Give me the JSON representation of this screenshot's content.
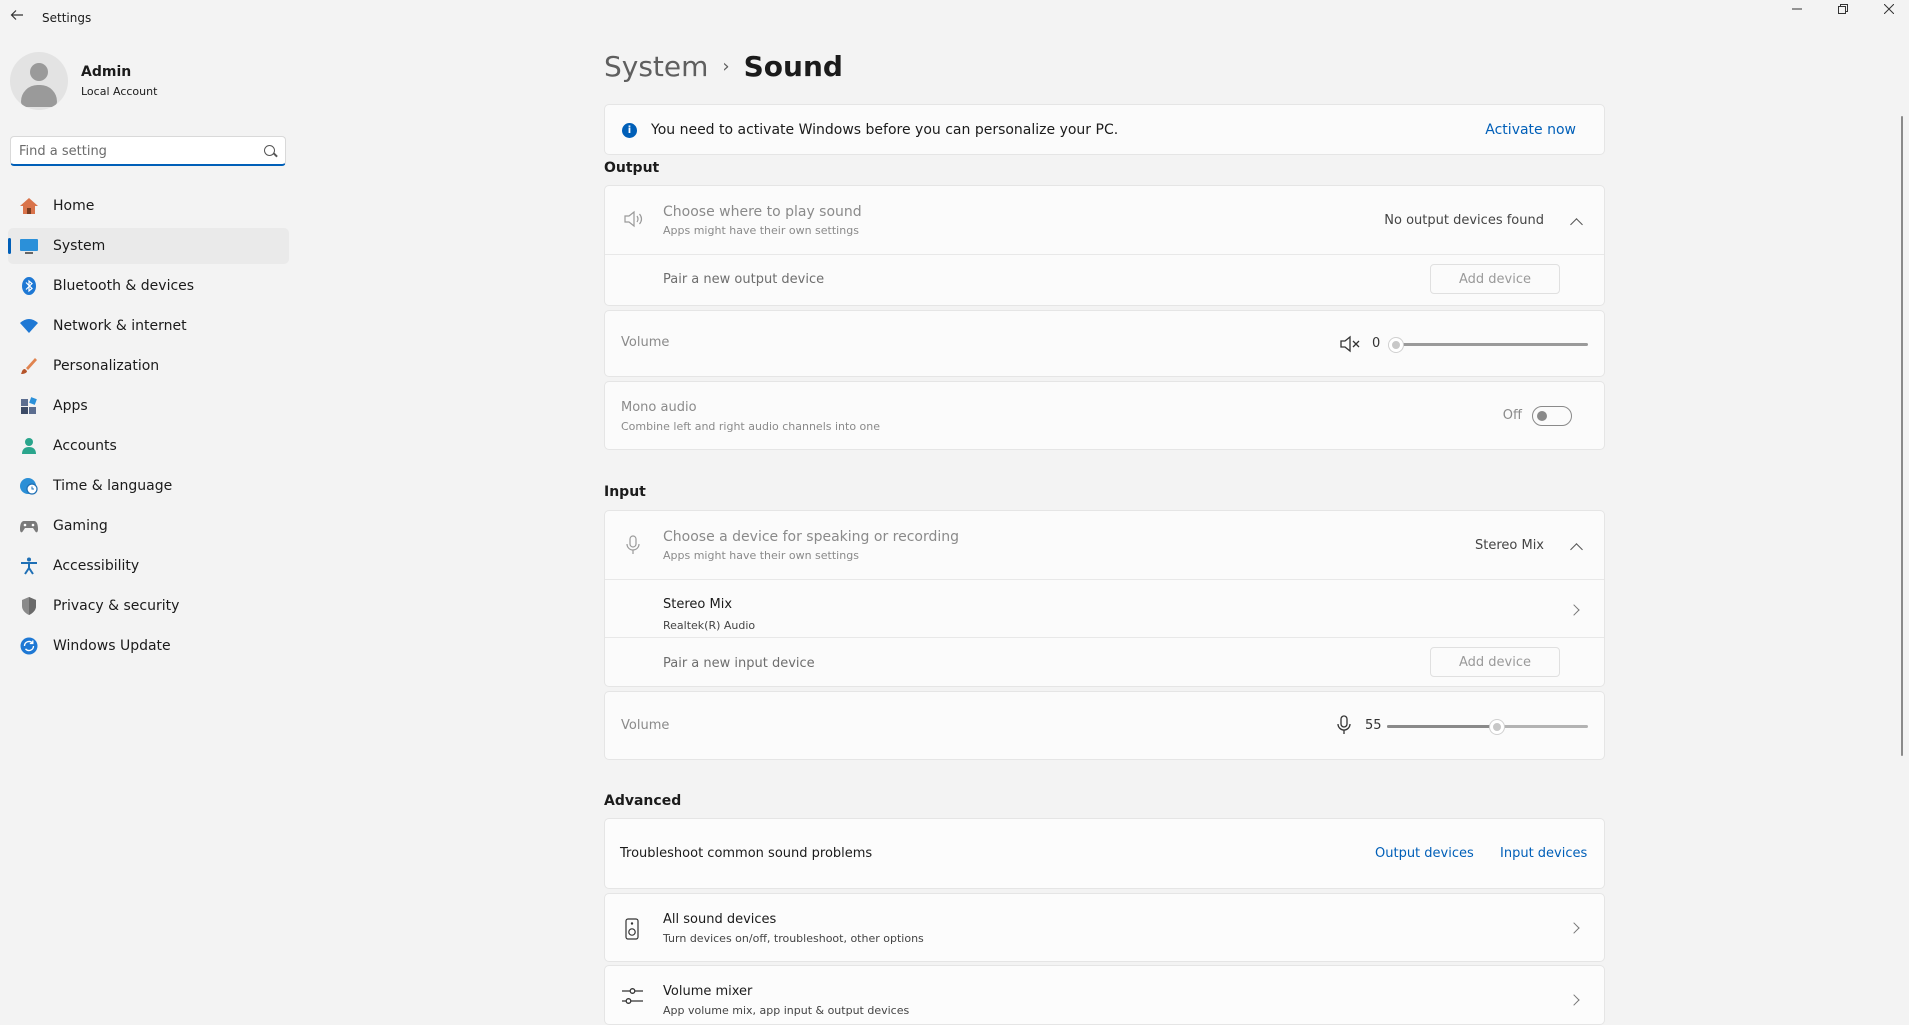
{
  "window": {
    "title": "Settings"
  },
  "user": {
    "name": "Admin",
    "account_type": "Local Account"
  },
  "search": {
    "placeholder": "Find a setting"
  },
  "nav": [
    {
      "label": "Home",
      "icon": "home-icon"
    },
    {
      "label": "System",
      "icon": "system-icon",
      "selected": true
    },
    {
      "label": "Bluetooth & devices",
      "icon": "bluetooth-icon"
    },
    {
      "label": "Network & internet",
      "icon": "wifi-icon"
    },
    {
      "label": "Personalization",
      "icon": "brush-icon"
    },
    {
      "label": "Apps",
      "icon": "apps-icon"
    },
    {
      "label": "Accounts",
      "icon": "person-icon"
    },
    {
      "label": "Time & language",
      "icon": "clock-globe-icon"
    },
    {
      "label": "Gaming",
      "icon": "gamepad-icon"
    },
    {
      "label": "Accessibility",
      "icon": "accessibility-icon"
    },
    {
      "label": "Privacy & security",
      "icon": "shield-icon"
    },
    {
      "label": "Windows Update",
      "icon": "update-icon"
    }
  ],
  "breadcrumb": {
    "parent": "System",
    "separator": "›",
    "current": "Sound"
  },
  "banner": {
    "message": "You need to activate Windows before you can personalize your PC.",
    "action": "Activate now",
    "icon": "info-icon"
  },
  "output": {
    "section_title": "Output",
    "device_choice": {
      "title": "Choose where to play sound",
      "subtitle": "Apps might have their own settings",
      "value": "No output devices found"
    },
    "pair": {
      "label": "Pair a new output device",
      "button": "Add device"
    },
    "volume": {
      "label": "Volume",
      "value": "0",
      "level": 0,
      "icon": "speaker-muted-icon"
    },
    "mono": {
      "title": "Mono audio",
      "subtitle": "Combine left and right audio channels into one",
      "state": "Off"
    }
  },
  "input": {
    "section_title": "Input",
    "device_choice": {
      "title": "Choose a device for speaking or recording",
      "subtitle": "Apps might have their own settings",
      "value": "Stereo Mix"
    },
    "device": {
      "name": "Stereo Mix",
      "detail": "Realtek(R) Audio"
    },
    "pair": {
      "label": "Pair a new input device",
      "button": "Add device"
    },
    "volume": {
      "label": "Volume",
      "value": "55",
      "level": 0.55,
      "icon": "microphone-icon"
    }
  },
  "advanced": {
    "section_title": "Advanced",
    "troubleshoot": {
      "label": "Troubleshoot common sound problems",
      "link_output": "Output devices",
      "link_input": "Input devices"
    },
    "all_devices": {
      "title": "All sound devices",
      "subtitle": "Turn devices on/off, troubleshoot, other options"
    },
    "mixer": {
      "title": "Volume mixer",
      "subtitle": "App volume mix, app input & output devices"
    }
  },
  "colors": {
    "accent": "#005fb8",
    "background": "#f3f3f3",
    "card": "#fbfbfb"
  }
}
